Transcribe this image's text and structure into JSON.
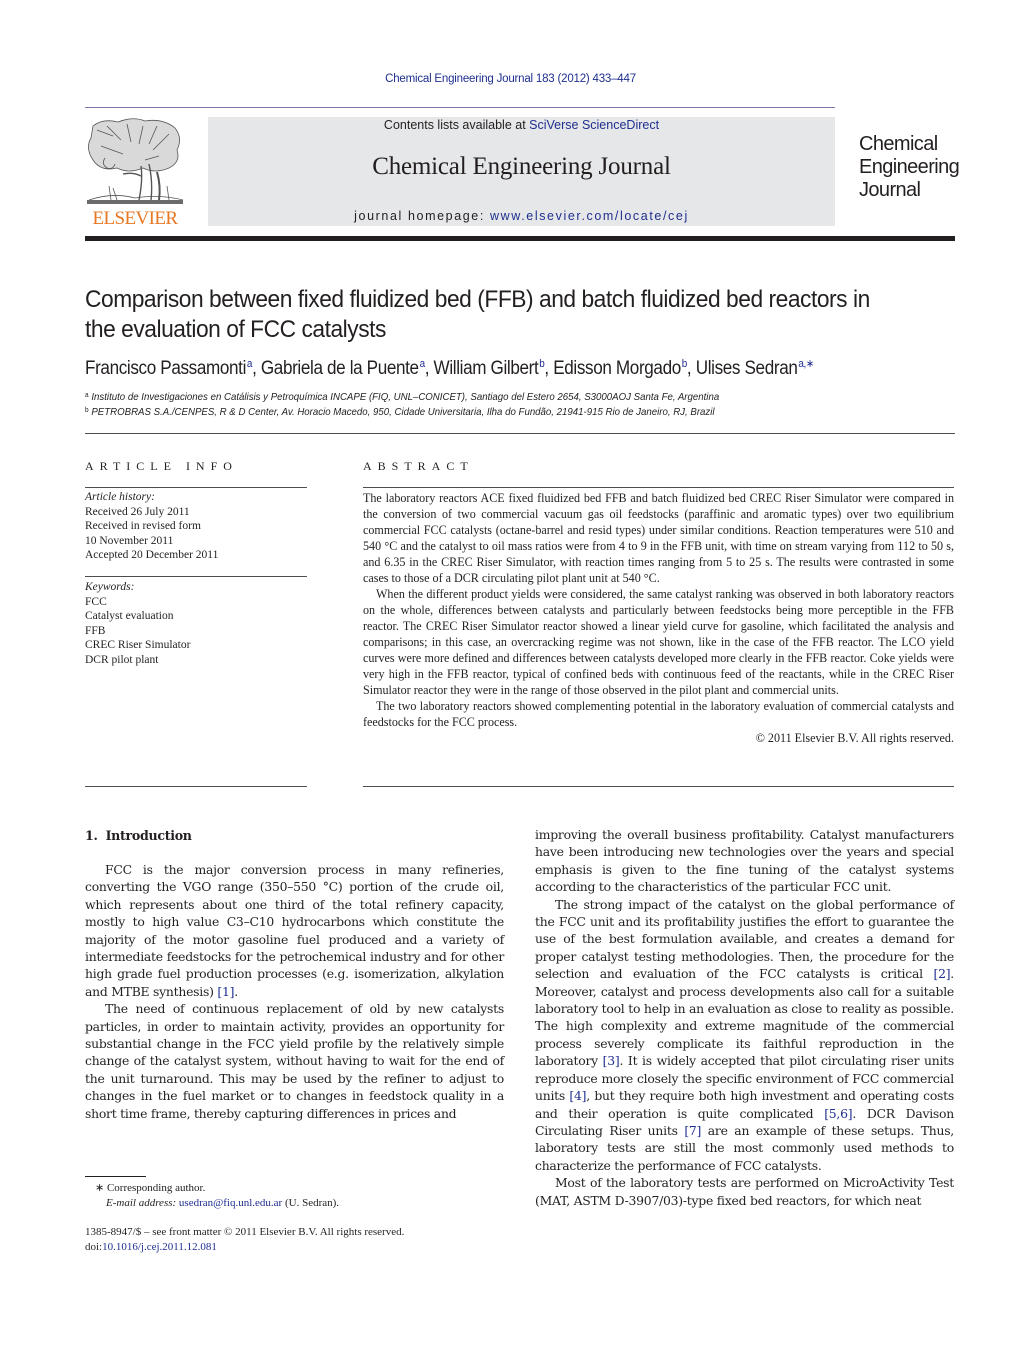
{
  "header": {
    "running_head": "Chemical Engineering Journal 183 (2012) 433–447",
    "publisher_logo_icon": "elsevier-tree-logo",
    "publisher_wordmark": "ELSEVIER",
    "contents_prefix": "Contents lists available at ",
    "contents_link": "SciVerse ScienceDirect",
    "journal_title": "Chemical Engineering Journal",
    "homepage_prefix": "journal homepage: ",
    "homepage_link": "www.elsevier.com/locate/cej",
    "cover_title_lines": [
      "Chemical",
      "Engineering",
      "Journal"
    ]
  },
  "article": {
    "title": "Comparison between fixed fluidized bed (FFB) and batch fluidized bed reactors in the evaluation of FCC catalysts",
    "authors": [
      {
        "name": "Francisco Passamonti",
        "affil": "a",
        "sep": ", "
      },
      {
        "name": "Gabriela de la Puente",
        "affil": "a",
        "sep": ", "
      },
      {
        "name": "William Gilbert",
        "affil": "b",
        "sep": ", "
      },
      {
        "name": "Edisson Morgado",
        "affil": "b",
        "sep": ", "
      },
      {
        "name": "Ulises Sedran",
        "affil": "a,∗",
        "sep": ""
      }
    ],
    "affiliations": [
      {
        "mark": "a",
        "text": "Instituto de Investigaciones en Catálisis y Petroquímica INCAPE (FIQ, UNL–CONICET), Santiago del Estero 2654, S3000AOJ Santa Fe, Argentina"
      },
      {
        "mark": "b",
        "text": "PETROBRAS S.A./CENPES, R & D Center, Av. Horacio Macedo, 950, Cidade Universitaria, Ilha do Fundão, 21941-915 Rio de Janeiro, RJ, Brazil"
      }
    ]
  },
  "article_info": {
    "heading": "ARTICLE INFO",
    "history_label": "Article history:",
    "history": [
      "Received 26 July 2011",
      "Received in revised form",
      "10 November 2011",
      "Accepted 20 December 2011"
    ],
    "keywords_label": "Keywords:",
    "keywords": [
      "FCC",
      "Catalyst evaluation",
      "FFB",
      "CREC Riser Simulator",
      "DCR pilot plant"
    ]
  },
  "abstract": {
    "heading": "ABSTRACT",
    "paragraphs": [
      "The laboratory reactors ACE fixed fluidized bed FFB and batch fluidized bed CREC Riser Simulator were compared in the conversion of two commercial vacuum gas oil feedstocks (paraffinic and aromatic types) over two equilibrium commercial FCC catalysts (octane-barrel and resid types) under similar conditions. Reaction temperatures were 510 and 540 °C and the catalyst to oil mass ratios were from 4 to 9 in the FFB unit, with time on stream varying from 112 to 50 s, and 6.35 in the CREC Riser Simulator, with reaction times ranging from 5 to 25 s. The results were contrasted in some cases to those of a DCR circulating pilot plant unit at 540 °C.",
      "When the different product yields were considered, the same catalyst ranking was observed in both laboratory reactors on the whole, differences between catalysts and particularly between feedstocks being more perceptible in the FFB reactor. The CREC Riser Simulator reactor showed a linear yield curve for gasoline, which facilitated the analysis and comparisons; in this case, an overcracking regime was not shown, like in the case of the FFB reactor. The LCO yield curves were more defined and differences between catalysts developed more clearly in the FFB reactor. Coke yields were very high in the FFB reactor, typical of confined beds with continuous feed of the reactants, while in the CREC Riser Simulator reactor they were in the range of those observed in the pilot plant and commercial units.",
      "The two laboratory reactors showed complementing potential in the laboratory evaluation of commercial catalysts and feedstocks for the FCC process."
    ],
    "copyright": "© 2011 Elsevier B.V. All rights reserved."
  },
  "introduction": {
    "number": "1.",
    "heading": "Introduction",
    "left_paragraphs": [
      {
        "parts": [
          {
            "text": "FCC is the major conversion process in many refineries, converting the VGO range (350–550 °C) portion of the crude oil, which represents about one third of the total refinery capacity, mostly to high value C3–C10 hydrocarbons which constitute the majority of the motor gasoline fuel produced and a variety of intermediate feedstocks for the petrochemical industry and for other high grade fuel production processes (e.g. isomerization, alkylation and MTBE synthesis) "
          },
          {
            "text": "[1]",
            "ref": true
          },
          {
            "text": "."
          }
        ]
      },
      {
        "parts": [
          {
            "text": "The need of continuous replacement of old by new catalysts particles, in order to maintain activity, provides an opportunity for substantial change in the FCC yield profile by the relatively simple change of the catalyst system, without having to wait for the end of the unit turnaround. This may be used by the refiner to adjust to changes in the fuel market or to changes in feedstock quality in a short time frame, thereby capturing differences in prices and"
          }
        ]
      }
    ],
    "right_paragraphs": [
      {
        "noindent": true,
        "parts": [
          {
            "text": "improving the overall business profitability. Catalyst manufacturers have been introducing new technologies over the years and special emphasis is given to the fine tuning of the catalyst systems according to the characteristics of the particular FCC unit."
          }
        ]
      },
      {
        "parts": [
          {
            "text": "The strong impact of the catalyst on the global performance of the FCC unit and its profitability justifies the effort to guarantee the use of the best formulation available, and creates a demand for proper catalyst testing methodologies. Then, the procedure for the selection and evaluation of the FCC catalysts is critical "
          },
          {
            "text": "[2]",
            "ref": true
          },
          {
            "text": ". Moreover, catalyst and process developments also call for a suitable laboratory tool to help in an evaluation as close to reality as possible. The high complexity and extreme magnitude of the commercial process severely complicate its faithful reproduction in the laboratory "
          },
          {
            "text": "[3]",
            "ref": true
          },
          {
            "text": ". It is widely accepted that pilot circulating riser units reproduce more closely the specific environment of FCC commercial units "
          },
          {
            "text": "[4]",
            "ref": true
          },
          {
            "text": ", but they require both high investment and operating costs and their operation is quite complicated "
          },
          {
            "text": "[5,6]",
            "ref": true
          },
          {
            "text": ". DCR Davison Circulating Riser units "
          },
          {
            "text": "[7]",
            "ref": true
          },
          {
            "text": " are an example of these setups. Thus, laboratory tests are still the most commonly used methods to characterize the performance of FCC catalysts."
          }
        ]
      },
      {
        "parts": [
          {
            "text": "Most of the laboratory tests are performed on MicroActivity Test (MAT, ASTM D-3907/03)-type fixed bed reactors, for which neat"
          }
        ]
      }
    ]
  },
  "footnotes": {
    "corresponding_mark": "∗",
    "corresponding_text": "Corresponding author.",
    "email_label": "E-mail address:",
    "email": "usedran@fiq.unl.edu.ar",
    "email_suffix": " (U. Sedran).",
    "front_matter": "1385-8947/$ – see front matter © 2011 Elsevier B.V. All rights reserved.",
    "doi_prefix": "doi:",
    "doi": "10.1016/j.cej.2011.12.081"
  },
  "colors": {
    "link": "#1f2f8f",
    "elsevier_orange": "#e87722",
    "masthead_gray": "#e6e7e8",
    "text": "#231f20"
  }
}
